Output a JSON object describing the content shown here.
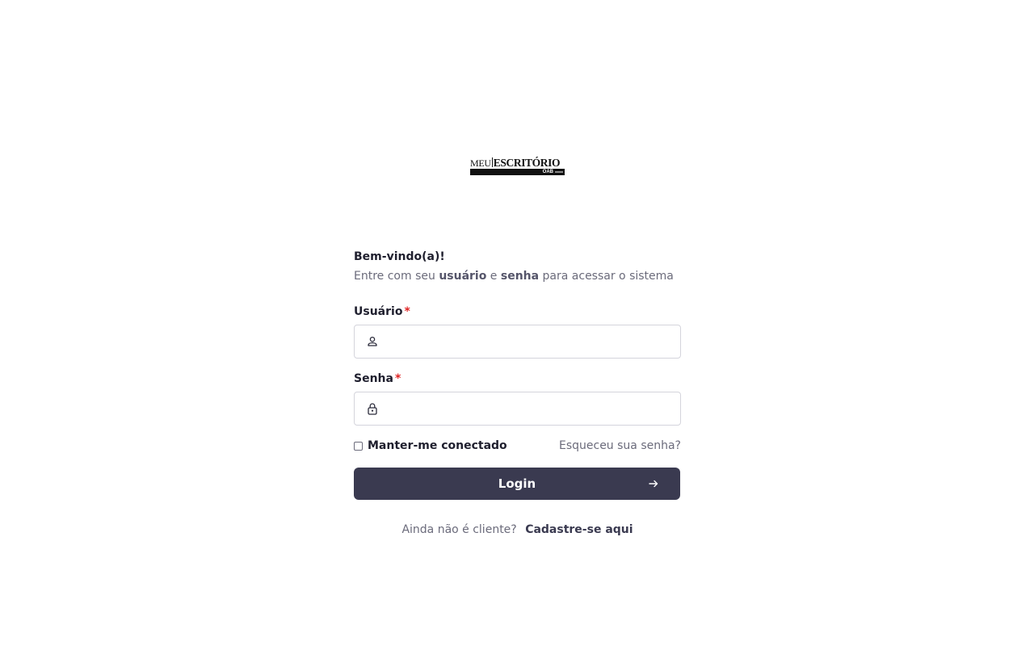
{
  "brand": {
    "logo_top_left": "MEU",
    "logo_top_right": "ESCRITÓRIO",
    "logo_sub": "OAB"
  },
  "welcome": {
    "title": "Bem-vindo(a)!",
    "sub_prefix": "Entre com seu ",
    "sub_user": "usuário",
    "sub_mid": " e ",
    "sub_pass": "senha",
    "sub_suffix": " para acessar o sistema"
  },
  "form": {
    "user_label": "Usuário",
    "pass_label": "Senha",
    "required_mark": "*",
    "user_value": "",
    "pass_value": "",
    "remember_label": "Manter-me conectado",
    "remember_checked": false,
    "forgot_link": "Esqueceu sua senha?",
    "login_button": "Login"
  },
  "signup": {
    "question": "Ainda não é cliente?",
    "link": "Cadastre-se aqui"
  },
  "colors": {
    "primary": "#3a3a50",
    "required": "#e02424",
    "muted_text": "#6b6b7b",
    "border": "#d4d4dc"
  },
  "icons": {
    "user_field": "user-icon",
    "password_field": "lock-icon",
    "login_button": "arrow-right-icon"
  }
}
